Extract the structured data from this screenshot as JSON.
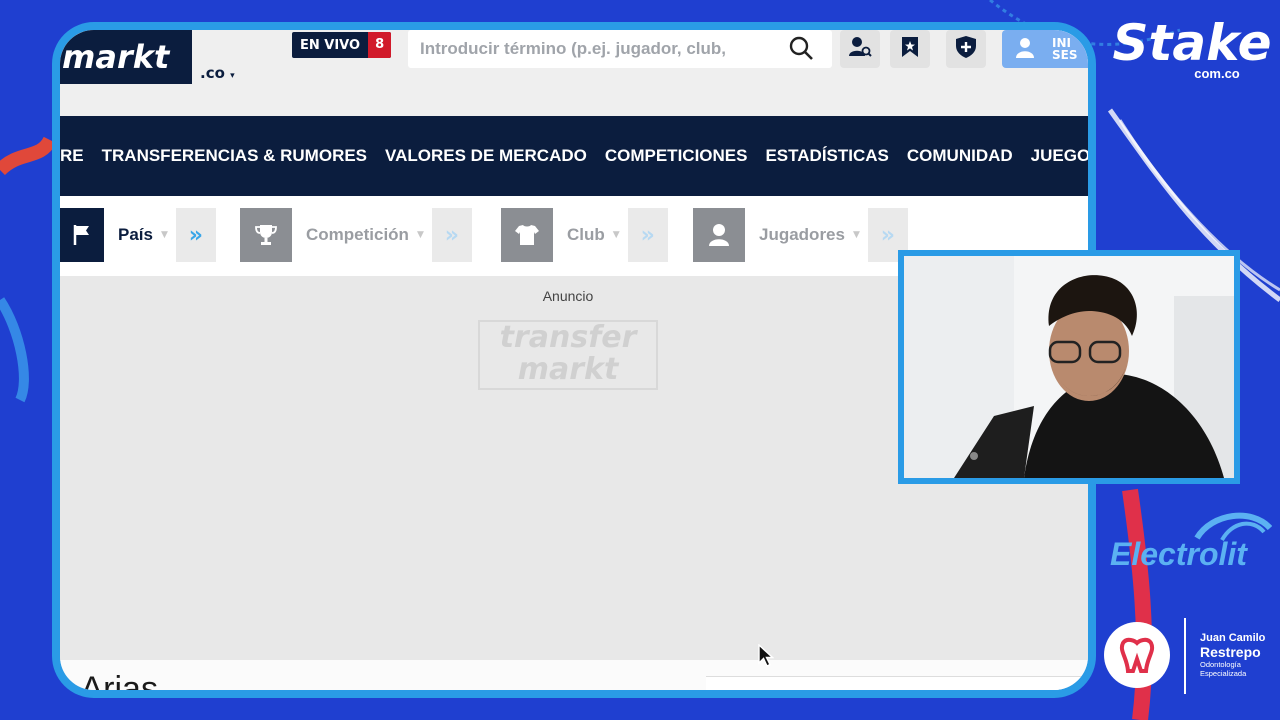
{
  "browser": {
    "logo_text": "markt",
    "domain": ".co",
    "live": {
      "label": "EN VIVO",
      "count": "8"
    },
    "search": {
      "placeholder": "Introducir término (p.ej. jugador, club,"
    },
    "login_label": "INI SES",
    "nav": [
      "RE",
      "TRANSFERENCIAS & RUMORES",
      "VALORES DE MERCADO",
      "COMPETICIONES",
      "ESTADÍSTICAS",
      "COMUNIDAD",
      "JUEGOS"
    ],
    "filters": [
      {
        "label": "País",
        "icon": "flag-icon"
      },
      {
        "label": "Competición",
        "icon": "trophy-icon"
      },
      {
        "label": "Club",
        "icon": "shirt-icon"
      },
      {
        "label": "Jugadores",
        "icon": "person-icon"
      }
    ],
    "ad_label": "Anuncio",
    "ad_logo": [
      "transfer",
      "markt"
    ],
    "player_name_partial": "o Arias"
  },
  "overlay": {
    "sponsor_main": {
      "name": "Stake",
      "domain": "com.co"
    },
    "sponsor_secondary": "Electrolit",
    "sponsor_dentist": {
      "line1": "Juan Camilo",
      "line2": "Restrepo",
      "line3": "Odontología Especializada"
    }
  },
  "colors": {
    "bg": "#1f3fd0",
    "frame": "#2a9be6",
    "nav": "#0b1d3e",
    "live_count": "#d11a2a"
  }
}
